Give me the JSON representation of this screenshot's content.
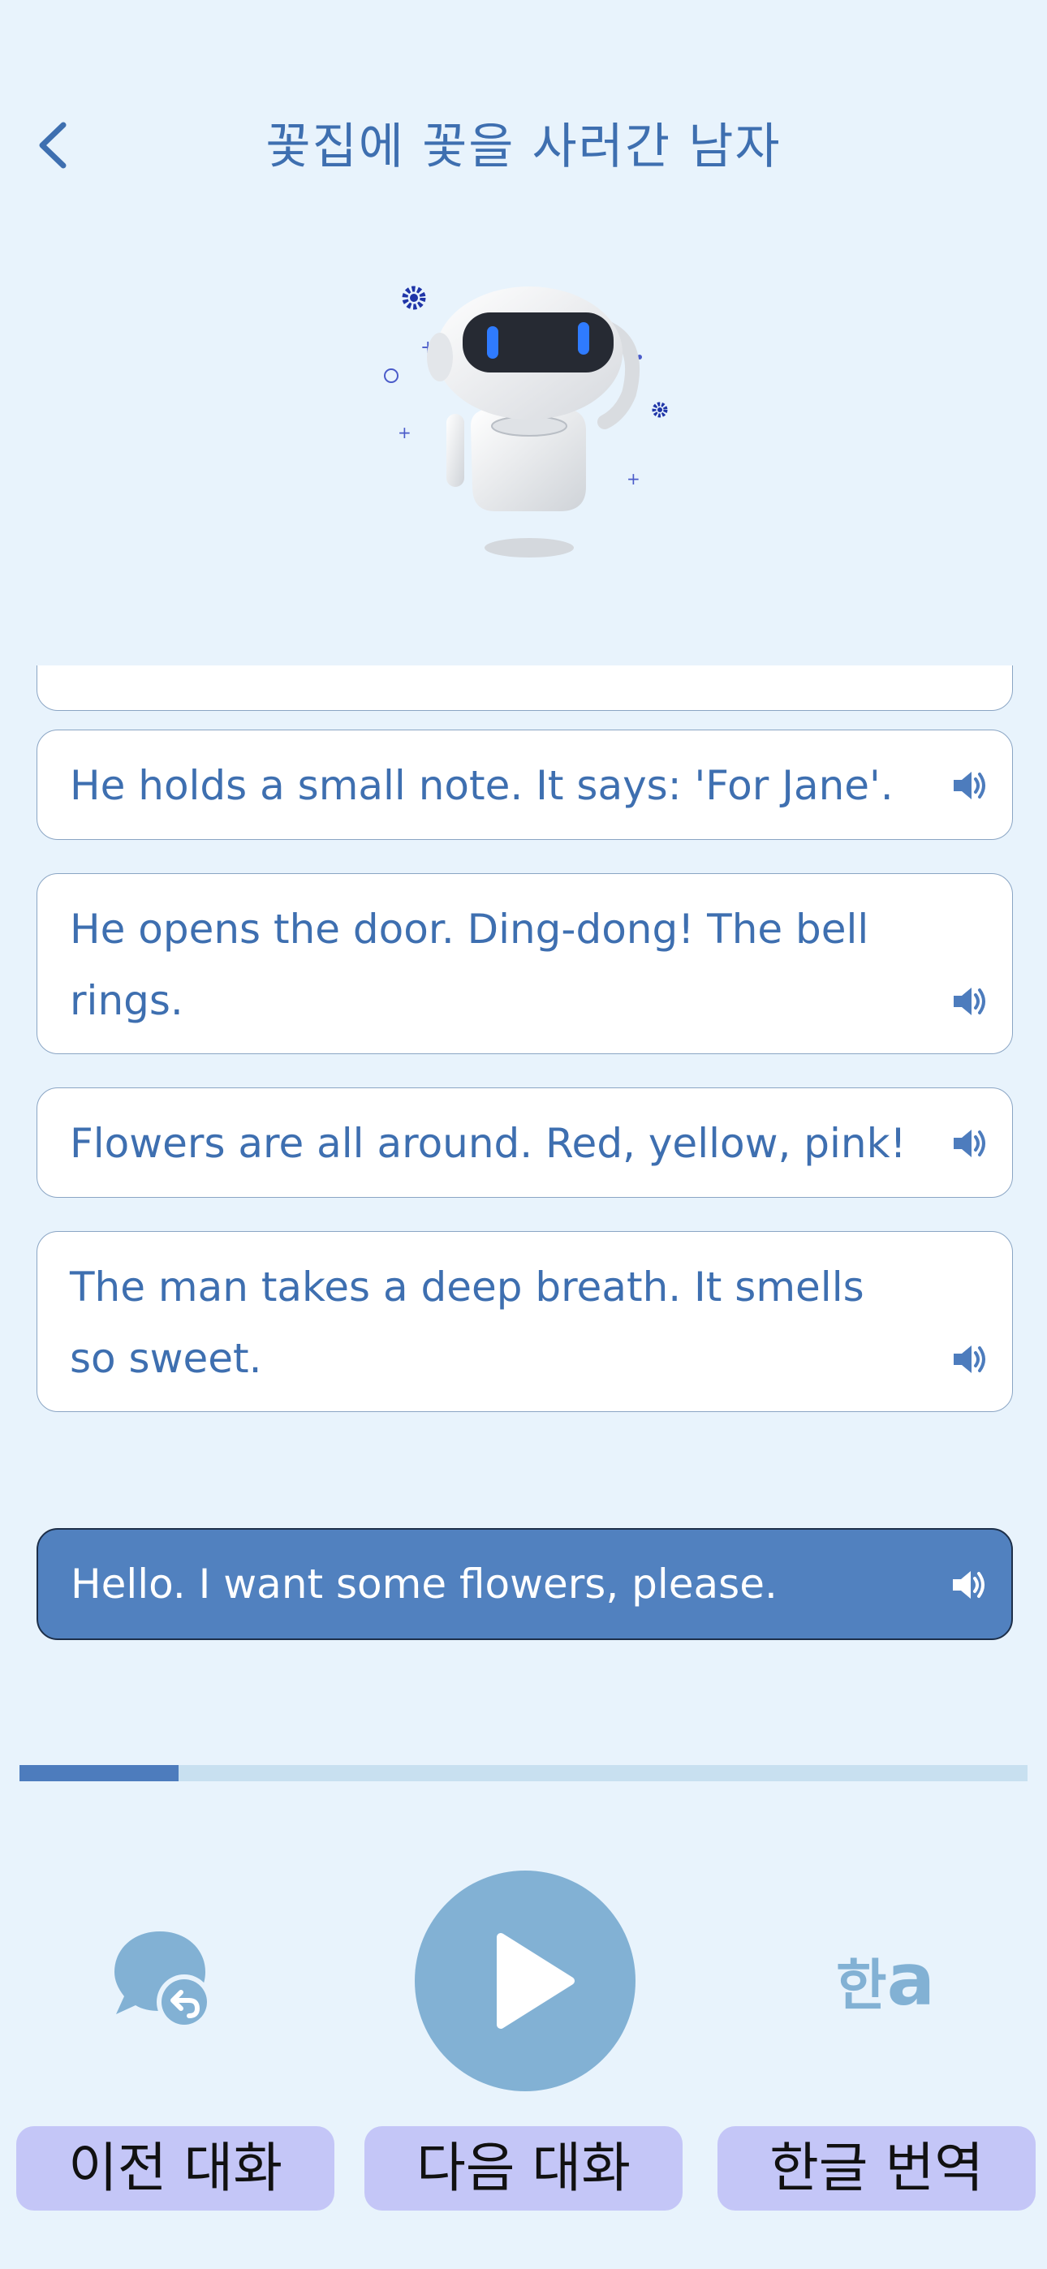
{
  "header": {
    "title": "꽃집에 꽃을 사러간 남자"
  },
  "icons": {
    "back": "chevron-left-icon",
    "speaker": "speaker-icon",
    "previous": "chat-bubble-return-icon",
    "play": "play-icon",
    "translate": "hangul-a-icon"
  },
  "dialogue": {
    "lines": [
      "He holds a small note. It says: 'For Jane'.",
      "He opens the door. Ding-dong! The bell rings.",
      "Flowers are all around. Red, yellow, pink!",
      "The man takes a deep breath. It smells so sweet."
    ],
    "current": "Hello. I want some flowers, please."
  },
  "progress": {
    "fraction": 0.158
  },
  "controls": {
    "translate_glyph_ko": "한",
    "translate_glyph_en": "a",
    "prev_label": "이전 대화",
    "next_label": "다음 대화",
    "translate_label": "한글 번역"
  },
  "colors": {
    "background": "#e8f3fc",
    "accent": "#5181bf",
    "title": "#3e6fb0",
    "progress_fill": "#4d7cbd",
    "progress_track": "#c8e0f0",
    "button_bg": "#c4c6f7",
    "play_circle": "#82b1d4"
  }
}
